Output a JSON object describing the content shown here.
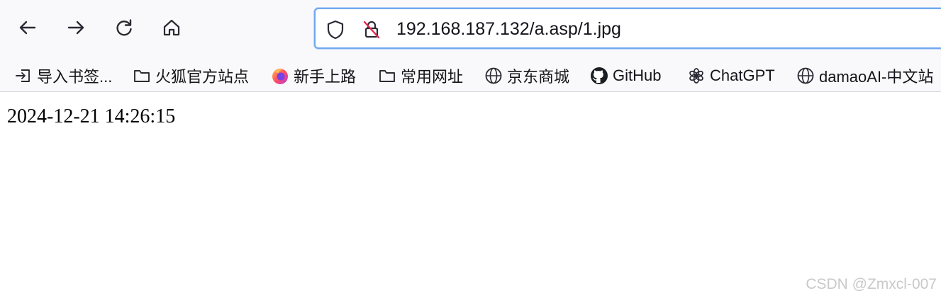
{
  "toolbar": {
    "back_icon": "arrow-left-icon",
    "forward_icon": "arrow-right-icon",
    "reload_icon": "reload-icon",
    "home_icon": "home-icon"
  },
  "urlbar": {
    "url": "192.168.187.132/a.asp/1.jpg",
    "tracking_icon": "shield-icon",
    "security_icon": "insecure-lock-icon",
    "border_color": "#6ea8f0"
  },
  "bookmarks": [
    {
      "label": "导入书签...",
      "icon": "import-icon"
    },
    {
      "label": "火狐官方站点",
      "icon": "folder-icon"
    },
    {
      "label": "新手上路",
      "icon": "firefox-icon"
    },
    {
      "label": "常用网址",
      "icon": "folder-icon"
    },
    {
      "label": "京东商城",
      "icon": "globe-icon"
    },
    {
      "label": "GitHub",
      "icon": "github-icon"
    },
    {
      "label": "ChatGPT",
      "icon": "chatgpt-icon"
    },
    {
      "label": "damaoAI-中文站",
      "icon": "globe-icon"
    }
  ],
  "page": {
    "text": "2024-12-21 14:26:15"
  },
  "watermark": "CSDN @Zmxcl-007"
}
